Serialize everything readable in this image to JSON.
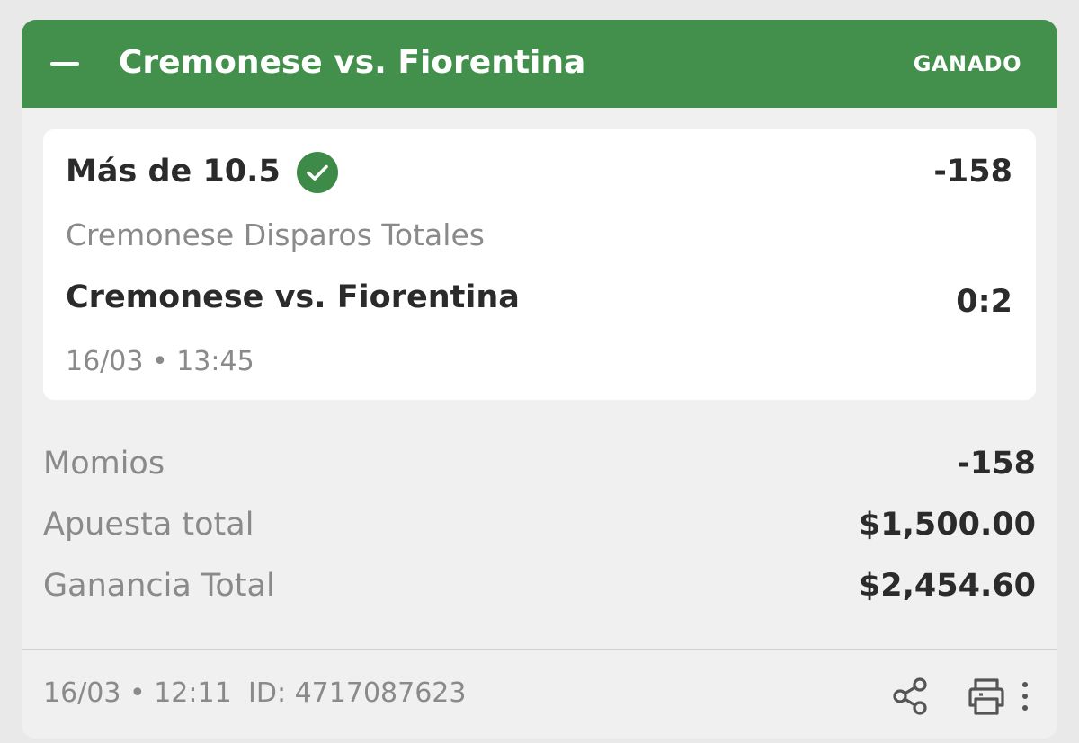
{
  "header": {
    "title": "Cremonese vs. Fiorentina",
    "status": "GANADO",
    "collapse_icon": "minus-icon",
    "color": "#43904d"
  },
  "selection": {
    "name": "Más de 10.5",
    "status_icon": "check-circle-icon",
    "odds": "-158",
    "market": "Cremonese Disparos Totales",
    "event": "Cremonese vs. Fiorentina",
    "score": "0:2",
    "datetime": "16/03 • 13:45"
  },
  "summary": {
    "odds_label": "Momios",
    "odds_value": "-158",
    "stake_label": "Apuesta total",
    "stake_value": "$1,500.00",
    "payout_label": "Ganancia Total",
    "payout_value": "$2,454.60"
  },
  "footer": {
    "datetime": "16/03 • 12:11",
    "id": "ID: 4717087623",
    "share_icon": "share-icon",
    "print_icon": "print-icon",
    "more_icon": "more-vertical-icon"
  }
}
